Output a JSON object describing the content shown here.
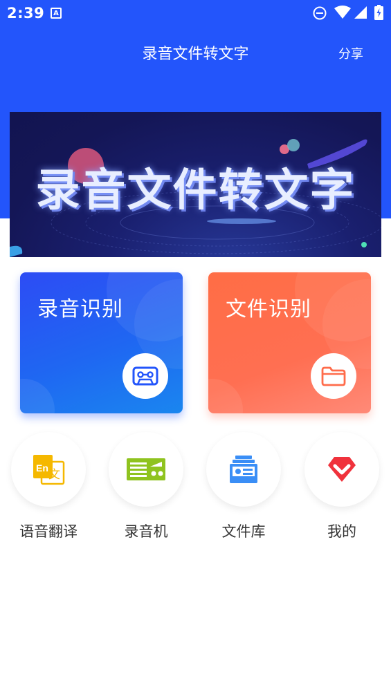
{
  "status_bar": {
    "time": "2:39",
    "icons": [
      "keyboard-a-icon",
      "do-not-disturb-icon",
      "wifi-icon",
      "signal-icon",
      "battery-icon"
    ]
  },
  "header": {
    "title": "录音文件转文字",
    "share_label": "分享",
    "background_color": "#2355fb"
  },
  "banner": {
    "text": "录音文件转文字"
  },
  "cards": [
    {
      "title": "录音识别",
      "icon": "cassette-icon",
      "color": "#2355fb"
    },
    {
      "title": "文件识别",
      "icon": "folder-icon",
      "color": "#ff6b4a"
    }
  ],
  "quick_actions": [
    {
      "label": "语音翻译",
      "icon": "translate-icon"
    },
    {
      "label": "录音机",
      "icon": "recorder-icon"
    },
    {
      "label": "文件库",
      "icon": "file-library-icon"
    },
    {
      "label": "我的",
      "icon": "profile-icon"
    }
  ]
}
